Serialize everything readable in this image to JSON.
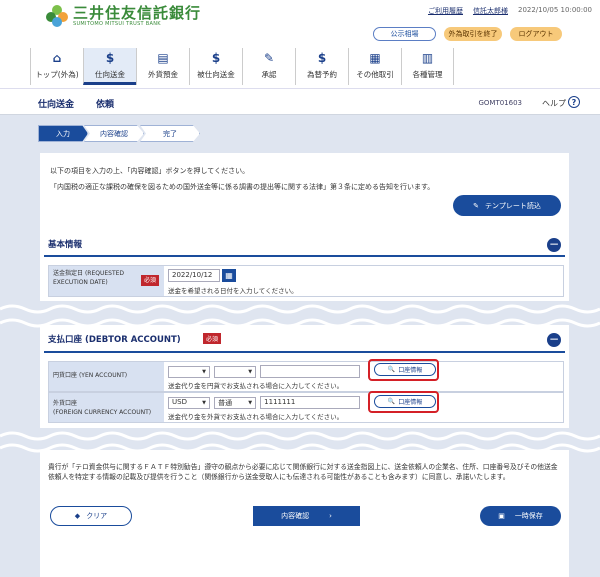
{
  "header": {
    "logo_jp": "三井住友信託銀行",
    "logo_en": "SUMITOMO MITSUI TRUST BANK",
    "links": {
      "usage": "ご利用履歴",
      "user": "信託太郎様",
      "timestamp": "2022/10/05 10:00:00"
    },
    "buttons": {
      "notice": "公示相場",
      "fx_end": "外為取引を終了",
      "logout": "ログアウト"
    },
    "nav": [
      {
        "label": "トップ(外為)",
        "icon": "home-icon"
      },
      {
        "label": "仕向送金",
        "icon": "remit-icon"
      },
      {
        "label": "外貨預金",
        "icon": "deposit-icon"
      },
      {
        "label": "被仕向送金",
        "icon": "incoming-icon"
      },
      {
        "label": "承認",
        "icon": "approve-icon"
      },
      {
        "label": "為替予約",
        "icon": "fx-contract-icon"
      },
      {
        "label": "その他取引",
        "icon": "other-icon"
      },
      {
        "label": "各種管理",
        "icon": "manage-icon"
      }
    ]
  },
  "page": {
    "crumb": "仕向送金",
    "title": "依頼",
    "code": "GOMT01603",
    "help": "ヘルプ"
  },
  "steps": [
    "入力",
    "内容確認",
    "完了"
  ],
  "intro": {
    "line1": "以下の項目を入力の上、「内容確認」ボタンを押してください。",
    "line2": "「内国税の適正な課税の確保を図るための国外送金等に係る調書の提出等に関する法律」第３条に定める告知を行います。",
    "template_btn": "テンプレート読込"
  },
  "basic": {
    "title": "基本情報",
    "exec_label_jp": "送金指定日",
    "exec_label_en": "(REQUESTED EXECUTION DATE)",
    "required": "必須",
    "date_value": "2022/10/12",
    "date_hint": "送金を希望される日付を入力してください。"
  },
  "debit": {
    "title": "支払口座 (DEBTOR ACCOUNT)",
    "required": "必須",
    "yen_label": "円貨口座",
    "yen_label_en": "(YEN ACCOUNT)",
    "yen_hint": "送金代り金を円貨でお支払される場合に入力してください。",
    "fx_label": "外貨口座",
    "fx_label_en": "(FOREIGN CURRENCY ACCOUNT)",
    "fx_currency": "USD",
    "fx_type": "普通",
    "fx_account": "1111111",
    "fx_hint": "送金代り金を外貨でお支払される場合に入力してください。",
    "account_info_btn": "口座情報"
  },
  "footer": {
    "notice": "貴行が「テロ資金供与に関するＦＡＴＦ特別勧告」遵守の観点から必要に応じて関係銀行に対する送金指図上に、送金依頼人の企業名、住所、口座番号及びその他送金依頼人を特定する情報の記載及び提供を行うこと（関係銀行から送金受取人にも伝達される可能性があることも含みます）に同意し、承諾いたします。",
    "clear": "クリア",
    "confirm": "内容確認",
    "save": "一時保存"
  },
  "colors": {
    "navy": "#1a4c9c",
    "highlight": "#d42027",
    "brand_green": "#3a8b3a"
  }
}
